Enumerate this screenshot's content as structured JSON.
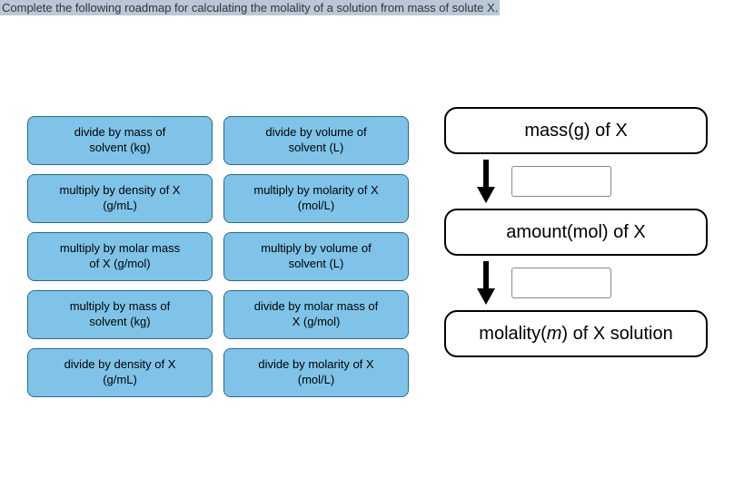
{
  "instruction": "Complete the following roadmap for calculating the molality of a solution from mass of solute X.",
  "options": [
    {
      "line1": "divide by mass of",
      "line2": "solvent (kg)"
    },
    {
      "line1": "divide by volume of",
      "line2": "solvent (L)"
    },
    {
      "line1": "multiply by density of X",
      "line2": "(g/mL)"
    },
    {
      "line1": "multiply by molarity of X",
      "line2": "(mol/L)"
    },
    {
      "line1": "multiply by molar mass",
      "line2": "of X (g/mol)"
    },
    {
      "line1": "multiply by volume of",
      "line2": "solvent (L)"
    },
    {
      "line1": "multiply by mass of",
      "line2": "solvent (kg)"
    },
    {
      "line1": "divide by molar mass of",
      "line2": "X (g/mol)"
    },
    {
      "line1": "divide by density of X",
      "line2": "(g/mL)"
    },
    {
      "line1": "divide by molarity of X",
      "line2": "(mol/L)"
    }
  ],
  "flow": {
    "step1": "mass(g) of X",
    "step2": "amount(mol) of X",
    "step3_prefix": "molality(",
    "step3_italic": "m",
    "step3_suffix": ") of X solution"
  }
}
